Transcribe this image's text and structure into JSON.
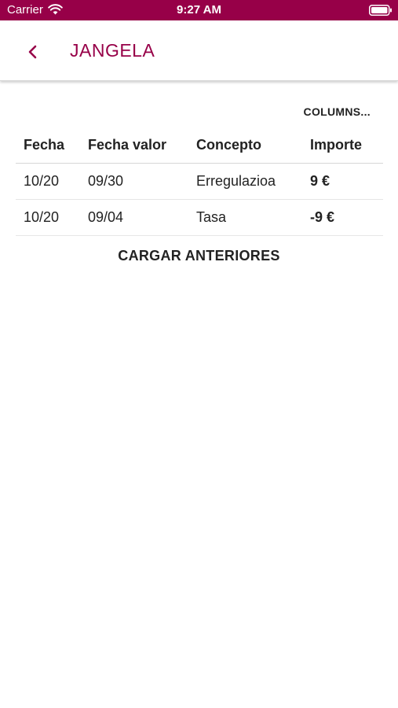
{
  "status_bar": {
    "carrier": "Carrier",
    "time": "9:27 AM",
    "wifi_icon": "wifi-icon",
    "battery_icon": "battery-icon"
  },
  "header": {
    "title": "JANGELA",
    "back_icon": "chevron-left-icon"
  },
  "toolbar": {
    "columns_label": "COLUMNS..."
  },
  "table": {
    "headers": [
      "Fecha",
      "Fecha valor",
      "Concepto",
      "Importe"
    ],
    "rows": [
      [
        "10/20",
        "09/30",
        "Erregulazioa",
        "9 €"
      ],
      [
        "10/20",
        "09/04",
        "Tasa",
        "-9 €"
      ]
    ]
  },
  "load_more_label": "CARGAR ANTERIORES",
  "colors": {
    "brand": "#970048",
    "text": "#222222",
    "divider": "#d6d6d6"
  }
}
